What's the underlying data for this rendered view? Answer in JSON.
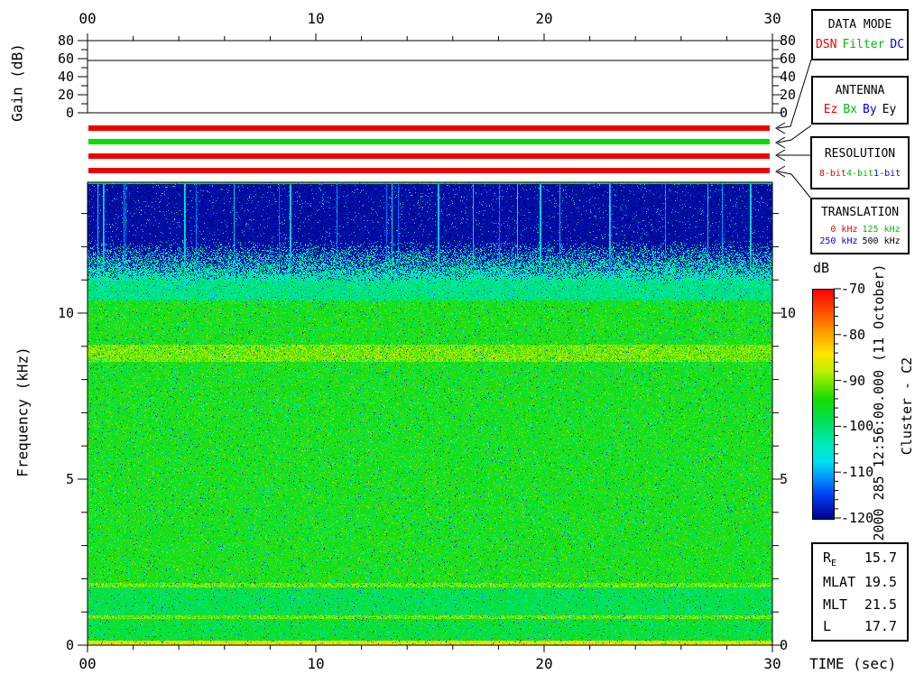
{
  "display": {
    "timestamp_label": "2000 285 12:56:00.000 (11 October)",
    "spacecraft_label": "Cluster - C2"
  },
  "gain_plot": {
    "ylabel": "Gain (dB)",
    "ytick_labels": [
      "0",
      "20",
      "40",
      "60",
      "80"
    ],
    "xtick_labels": [
      "00",
      "10",
      "20",
      "30"
    ]
  },
  "spectrogram_axes": {
    "ylabel": "Frequency (kHz)",
    "ytick_labels": [
      "0",
      "5",
      "10"
    ],
    "xtick_labels": [
      "00",
      "10",
      "20",
      "30"
    ],
    "xlabel": "TIME (sec)"
  },
  "colorbar": {
    "label": "dB",
    "tick_labels": [
      "-70",
      "-80",
      "-90",
      "-100",
      "-110",
      "-120"
    ]
  },
  "status_bars": [
    {
      "name": "data-mode-bar",
      "color": "#ee0000"
    },
    {
      "name": "antenna-bar",
      "color": "#00dd00"
    },
    {
      "name": "resolution-bar",
      "color": "#ee0000"
    },
    {
      "name": "translation-bar",
      "color": "#ee0000"
    }
  ],
  "panels": [
    {
      "id": "data-mode",
      "title": "DATA MODE",
      "options": [
        {
          "label": "DSN",
          "color": "#ee0000"
        },
        {
          "label": "Filter",
          "color": "#00bb00"
        },
        {
          "label": "DC",
          "color": "#0000ee"
        }
      ]
    },
    {
      "id": "antenna",
      "title": "ANTENNA",
      "options": [
        {
          "label": "Ez",
          "color": "#ee0000"
        },
        {
          "label": "Bx",
          "color": "#00bb00"
        },
        {
          "label": "By",
          "color": "#0000ee"
        },
        {
          "label": "Ey",
          "color": "#000000"
        }
      ]
    },
    {
      "id": "resolution",
      "title": "RESOLUTION",
      "options": [
        {
          "label": "8-bit",
          "color": "#ee0000"
        },
        {
          "label": "4-bit",
          "color": "#00bb00"
        },
        {
          "label": "1-bit",
          "color": "#0000ee"
        }
      ]
    },
    {
      "id": "translation",
      "title": "TRANSLATION",
      "options": [
        {
          "label": "0 kHz",
          "color": "#ee0000"
        },
        {
          "label": "125 kHz",
          "color": "#00bb00"
        },
        {
          "label": "250 kHz",
          "color": "#0000ee"
        },
        {
          "label": "500 kHz",
          "color": "#000000"
        }
      ]
    }
  ],
  "ephemeris": {
    "rows": [
      {
        "label": "R",
        "sub": "E",
        "value": "15.7"
      },
      {
        "label": "MLAT",
        "sub": "",
        "value": "19.5"
      },
      {
        "label": "MLT",
        "sub": "",
        "value": "21.5"
      },
      {
        "label": "L",
        "sub": "",
        "value": "17.7"
      }
    ]
  },
  "chart_data": [
    {
      "type": "line",
      "title": "Receiver gain vs time",
      "xlabel": "TIME (sec)",
      "ylabel": "Gain (dB)",
      "x_range_sec": [
        0,
        30
      ],
      "ylim": [
        0,
        80
      ],
      "xticks": [
        0,
        10,
        20,
        30
      ],
      "yticks": [
        0,
        20,
        40,
        60,
        80
      ],
      "minor_xtick_step_sec": 2,
      "series": [
        {
          "name": "gain_db",
          "shape": "constant",
          "value_db": 58
        }
      ]
    },
    {
      "type": "heatmap",
      "title": "Cluster C2 WBD spectrogram, 2000 285 12:56:00.000 (11 October)",
      "xlabel": "TIME (sec)",
      "ylabel": "Frequency (kHz)",
      "x_range_sec": [
        0,
        30
      ],
      "y_range_khz": [
        0,
        13.9
      ],
      "yticks_khz": [
        0,
        5,
        10
      ],
      "minor_ytick_step_khz": 1,
      "colorbar": {
        "label": "dB",
        "min_db": -120,
        "max_db": -70,
        "major_tick_db": 10,
        "minor_tick_db": 2,
        "legend_position": "right"
      },
      "background_level_db": -95,
      "features": [
        {
          "band_khz": [
            0.0,
            10.4
          ],
          "level_db": -95,
          "style": "speckle",
          "desc": "broadband green noise with cyan and dark dropout speckle"
        },
        {
          "band_khz": [
            10.4,
            11.0
          ],
          "level_db": -101,
          "style": "speckle",
          "desc": "cyan transition band"
        },
        {
          "band_khz": [
            11.0,
            12.2
          ],
          "level_db_bottom": -103,
          "level_db_top": -118.5,
          "style": "speckle_gradient",
          "desc": "speckled noise-floor transition brightening downward"
        },
        {
          "band_khz": [
            12.2,
            13.9
          ],
          "level_db": -119,
          "style": "quiet",
          "desc": "dark navy quiet background with sparse speckle"
        },
        {
          "band_khz": [
            8.55,
            9.05
          ],
          "level_db": -90.5,
          "style": "speckle",
          "desc": "faint yellow-green enhancement near 8.8 kHz"
        },
        {
          "band_khz": [
            0.9,
            1.78
          ],
          "level_db": -98,
          "style": "speckle",
          "desc": "slightly darker cyan-green band"
        },
        {
          "band_khz": [
            0.18,
            0.82
          ],
          "level_db": -97,
          "style": "speckle",
          "desc": "slightly darker band above the bottom edge"
        },
        {
          "line_khz": 1.82,
          "level_db": -91,
          "desc": "thin yellow-green line"
        },
        {
          "line_khz": 0.86,
          "level_db": -91,
          "desc": "thin yellow-green line"
        },
        {
          "band_khz": [
            0.0,
            0.15
          ],
          "level_db": -85,
          "style": "speckle",
          "desc": "yellow enhancement at lowest frequencies"
        }
      ],
      "interference_streaks": {
        "count": 26,
        "level_db_range": [
          -116,
          -104
        ],
        "extent_khz": [
          11.05,
          13.9
        ],
        "desc": "vertical blue interference streaks in the quiet upper band"
      }
    }
  ]
}
